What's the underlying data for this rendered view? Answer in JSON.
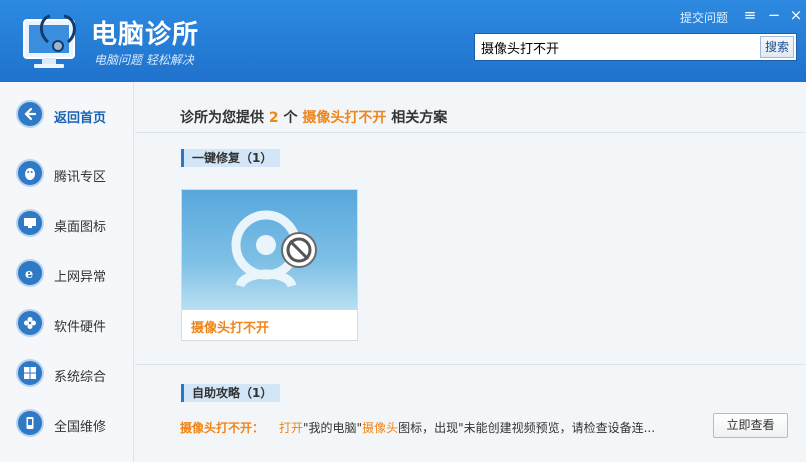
{
  "header": {
    "app_title": "电脑诊所",
    "slogan": "电脑问题  轻松解决",
    "feedback_link": "提交问题",
    "window_controls": {
      "menu": "≡",
      "minimize": "−",
      "close": "×"
    }
  },
  "search": {
    "value": "摄像头打不开",
    "button": "搜索"
  },
  "sidebar": {
    "items": [
      {
        "label": "返回首页",
        "icon": "back-arrow-icon"
      },
      {
        "label": "腾讯专区",
        "icon": "penguin-icon"
      },
      {
        "label": "桌面图标",
        "icon": "monitor-icon"
      },
      {
        "label": "上网异常",
        "icon": "ie-icon"
      },
      {
        "label": "软件硬件",
        "icon": "pinwheel-icon"
      },
      {
        "label": "系统综合",
        "icon": "windows-icon"
      },
      {
        "label": "全国维修",
        "icon": "phone-icon"
      }
    ]
  },
  "main": {
    "headline": {
      "prefix": "诊所为您提供",
      "count": "2",
      "middle": "个",
      "keyword": "摄像头打不开",
      "suffix": "相关方案"
    },
    "section_fix": "一键修复（1）",
    "card": {
      "title": "摄像头打不开",
      "icon": "webcam-disabled-icon"
    },
    "section_guide": "自助攻略（1）",
    "guide": {
      "title": "摄像头打不开：",
      "desc_parts": [
        {
          "text": "打开",
          "highlight": true
        },
        {
          "text": "\"我的电脑\"",
          "highlight": false
        },
        {
          "text": "摄像头",
          "highlight": true
        },
        {
          "text": "图标，出现\"未能创建视频预览，请检查设备连...",
          "highlight": false
        }
      ],
      "button": "立即查看"
    }
  },
  "colors": {
    "header_blue": "#1f72cd",
    "accent_orange": "#f08519",
    "nav_icon_blue": "#2f79c5"
  }
}
